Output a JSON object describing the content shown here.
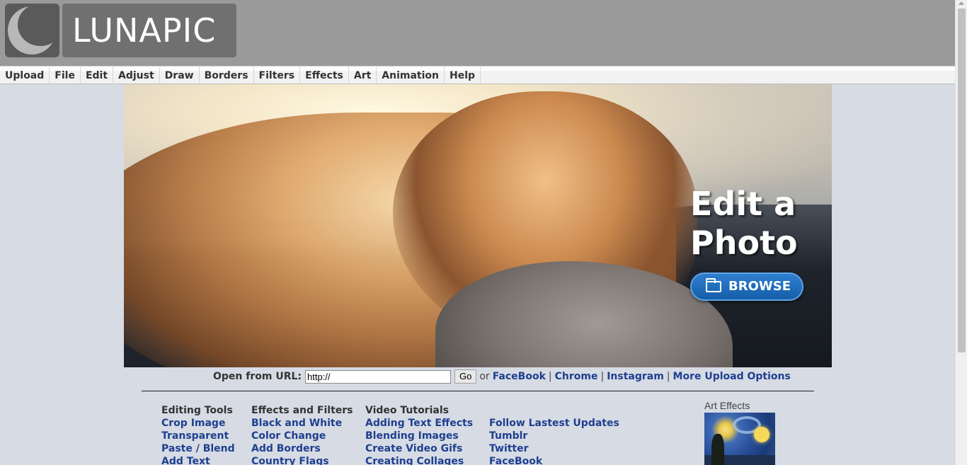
{
  "header": {
    "logo_text": "LUNAPIC"
  },
  "menu": {
    "items": [
      {
        "label": "Upload"
      },
      {
        "label": "File"
      },
      {
        "label": "Edit"
      },
      {
        "label": "Adjust"
      },
      {
        "label": "Draw"
      },
      {
        "label": "Borders"
      },
      {
        "label": "Filters"
      },
      {
        "label": "Effects"
      },
      {
        "label": "Art"
      },
      {
        "label": "Animation"
      },
      {
        "label": "Help"
      }
    ]
  },
  "hero": {
    "title_line1": "Edit a",
    "title_line2": "Photo",
    "browse_label": "BROWSE",
    "browse_icon": "folder-icon"
  },
  "url_row": {
    "label": "Open from URL:",
    "input_value": "http://",
    "go_label": "Go",
    "or_text": "or",
    "links": [
      "FaceBook",
      "Chrome",
      "Instagram",
      "More Upload Options"
    ],
    "separator": "|"
  },
  "columns": [
    {
      "heading": "Editing Tools",
      "links": [
        "Crop Image",
        "Transparent",
        "Paste / Blend",
        "Add Text"
      ]
    },
    {
      "heading": "Effects and Filters",
      "links": [
        "Black and White",
        "Color Change",
        "Add Borders",
        "Country Flags"
      ]
    },
    {
      "heading": "Video Tutorials",
      "links": [
        "Adding Text Effects",
        "Blending Images",
        "Create Video Gifs",
        "Creating Collages"
      ]
    },
    {
      "heading": "",
      "links": [
        "Follow Lastest Updates",
        "Tumblr",
        "Twitter",
        "FaceBook"
      ]
    }
  ],
  "art_effects": {
    "title": "Art Effects"
  },
  "colors": {
    "header_bg": "#9a9a9a",
    "page_bg": "#d6dbe4",
    "link": "#1f3f8f",
    "browse_button": "#1f6fbf"
  }
}
